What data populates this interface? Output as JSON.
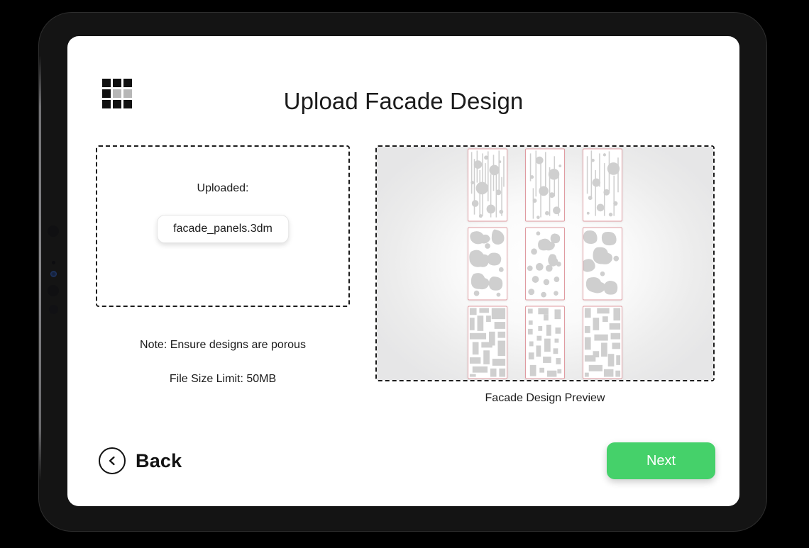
{
  "app": {
    "title": "Upload Facade Design",
    "logo_icon": "grid-3x3-icon"
  },
  "upload_panel": {
    "uploaded_label": "Uploaded:",
    "file_name": "facade_panels.3dm",
    "note": "Note: Ensure designs are porous",
    "size_limit": "File Size Limit: 50MB"
  },
  "preview_panel": {
    "caption": "Facade Design Preview",
    "rows": 3,
    "columns": 3,
    "panel_border_color": "#e09ba1",
    "pattern_fill_color": "#cfcfcf",
    "patterns": [
      [
        "vertical-lines-circles",
        "vertical-lines-circles",
        "vertical-lines-circles"
      ],
      [
        "organic-blobs",
        "organic-blobs",
        "organic-blobs"
      ],
      [
        "blocky-maze",
        "blocky-maze",
        "blocky-maze"
      ]
    ]
  },
  "footer": {
    "back_label": "Back",
    "back_icon": "chevron-left-circle-icon",
    "next_label": "Next",
    "next_color": "#45d16a"
  }
}
